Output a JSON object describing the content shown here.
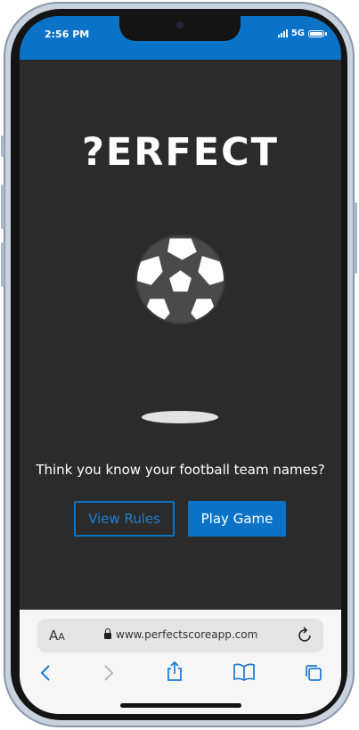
{
  "status": {
    "time": "2:56 PM",
    "network": "5G"
  },
  "app": {
    "logo_text": "?ERFECT",
    "tagline": "Think you know your football team names?",
    "view_rules_label": "View Rules",
    "play_game_label": "Play Game"
  },
  "browser": {
    "text_size_label": "A",
    "text_size_label_small": "A",
    "url": "www.perfectscoreapp.com"
  },
  "colors": {
    "accent": "#0a73c8",
    "background": "#2b2b2b"
  }
}
